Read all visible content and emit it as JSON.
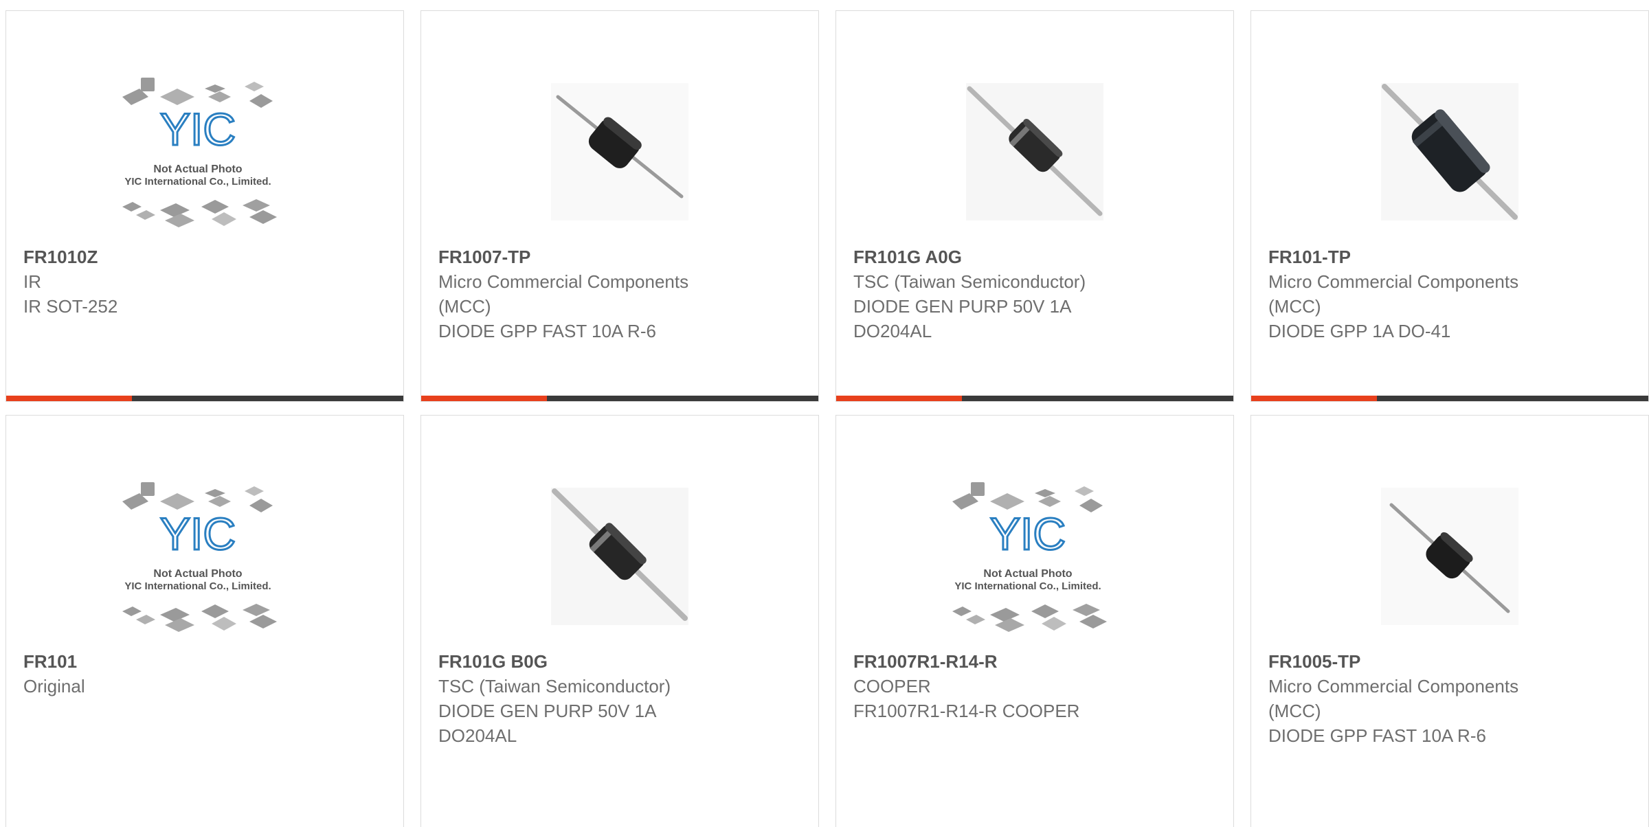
{
  "accent_color": "#e8401c",
  "bar_color": "#3a3a3a",
  "placeholder": {
    "line1": "Not Actual Photo",
    "line2": "YIC International Co., Limited.",
    "logo": "YIC"
  },
  "products": [
    {
      "part": "FR1010Z",
      "lines": [
        "IR",
        "IR SOT-252"
      ],
      "image": "placeholder-image"
    },
    {
      "part": "FR1007-TP",
      "lines": [
        "Micro Commercial Components (MCC)",
        "DIODE GPP FAST 10A R-6"
      ],
      "image": "diode-photo"
    },
    {
      "part": "FR101G A0G",
      "lines": [
        "TSC (Taiwan Semiconductor)",
        "DIODE GEN PURP 50V 1A DO204AL"
      ],
      "image": "diode-photo"
    },
    {
      "part": "FR101-TP",
      "lines": [
        "Micro Commercial Components (MCC)",
        "DIODE GPP 1A DO-41"
      ],
      "image": "diode-photo"
    },
    {
      "part": "FR101",
      "lines": [
        "Original"
      ],
      "image": "placeholder-image"
    },
    {
      "part": "FR101G B0G",
      "lines": [
        "TSC (Taiwan Semiconductor)",
        "DIODE GEN PURP 50V 1A DO204AL"
      ],
      "image": "diode-photo"
    },
    {
      "part": "FR1007R1-R14-R",
      "lines": [
        "COOPER",
        "FR1007R1-R14-R COOPER"
      ],
      "image": "placeholder-image"
    },
    {
      "part": "FR1005-TP",
      "lines": [
        "Micro Commercial Components (MCC)",
        "DIODE GPP FAST 10A R-6"
      ],
      "image": "diode-photo"
    }
  ]
}
